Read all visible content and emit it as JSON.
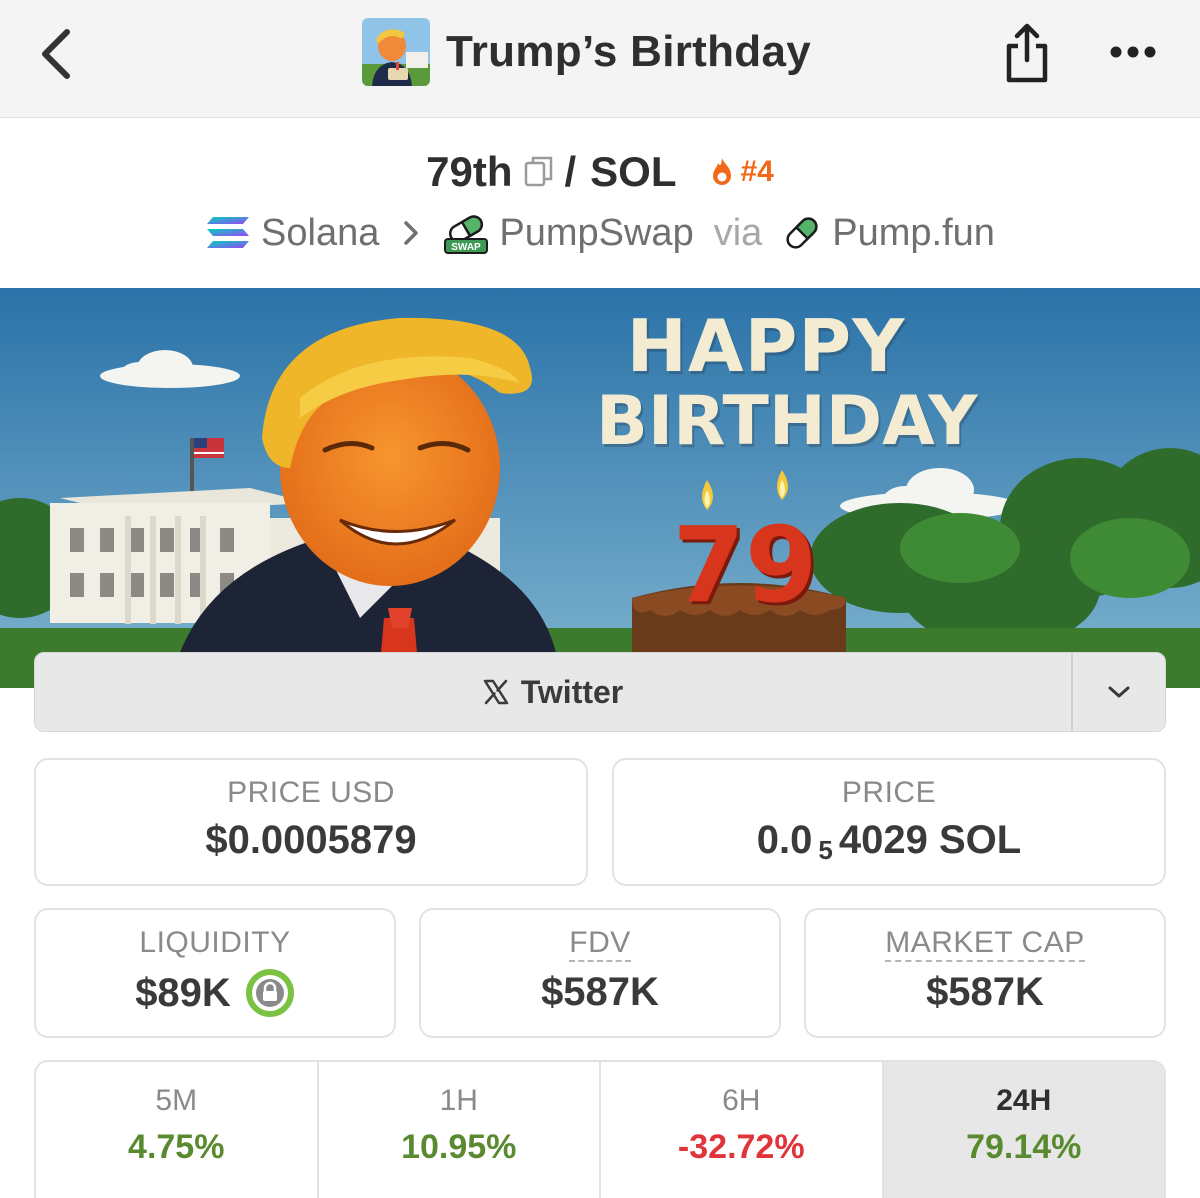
{
  "header": {
    "title": "Trump’s Birthday",
    "back_icon": "chevron-left-icon",
    "share_icon": "share-icon",
    "more_icon": "more-horizontal-icon"
  },
  "pair": {
    "base": "79th",
    "separator": "/",
    "quote": "SOL",
    "rank": "#4",
    "rank_color": "#f06a1a"
  },
  "chain": {
    "network": "Solana",
    "dex": "PumpSwap",
    "dex_badge": "SWAP",
    "via": "via",
    "launchpad": "Pump.fun"
  },
  "banner": {
    "line1": "HAPPY",
    "line2": "BIRTHDAY",
    "number": "79"
  },
  "social": {
    "label": "Twitter"
  },
  "stats": {
    "price_usd_label": "PRICE USD",
    "price_usd_value": "$0.0005879",
    "price_label": "PRICE",
    "price_prefix": "0.0",
    "price_subscript": "5",
    "price_suffix": "4029 SOL",
    "liquidity_label": "LIQUIDITY",
    "liquidity_value": "$89K",
    "fdv_label": "FDV",
    "fdv_value": "$587K",
    "mcap_label": "MARKET CAP",
    "mcap_value": "$587K"
  },
  "timeframes": [
    {
      "label": "5M",
      "value": "4.75%",
      "trend": "up"
    },
    {
      "label": "1H",
      "value": "10.95%",
      "trend": "up"
    },
    {
      "label": "6H",
      "value": "-32.72%",
      "trend": "down"
    },
    {
      "label": "24H",
      "value": "79.14%",
      "trend": "up",
      "active": true
    }
  ],
  "colors": {
    "up": "#5a8a30",
    "down": "#e0343a",
    "lock_ring": "#7cc242"
  }
}
